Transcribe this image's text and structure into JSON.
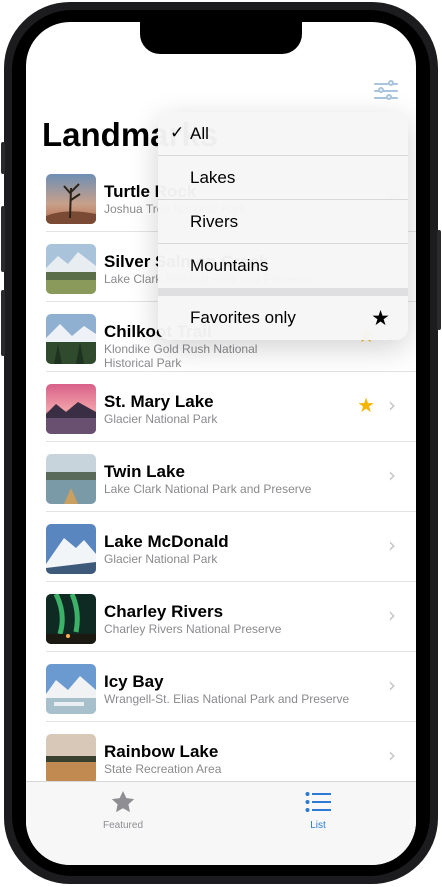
{
  "nav": {
    "title": "Landmarks",
    "filter_icon": "slider-horizontal-icon"
  },
  "filter_menu": {
    "items": [
      {
        "label": "All",
        "checked": true
      },
      {
        "label": "Lakes",
        "checked": false
      },
      {
        "label": "Rivers",
        "checked": false
      },
      {
        "label": "Mountains",
        "checked": false
      }
    ],
    "favorites_label": "Favorites only",
    "favorites_icon": "star-fill-icon"
  },
  "landmarks": [
    {
      "name": "Turtle Rock",
      "park": "Joshua Tree National Park",
      "favorite": false
    },
    {
      "name": "Silver Salmon Creek",
      "park": "Lake Clark National Park and Preserve",
      "favorite": false
    },
    {
      "name": "Chilkoot Trail",
      "park": "Klondike Gold Rush National Historical Park",
      "favorite": true
    },
    {
      "name": "St. Mary Lake",
      "park": "Glacier National Park",
      "favorite": true
    },
    {
      "name": "Twin Lake",
      "park": "Lake Clark National Park and Preserve",
      "favorite": false
    },
    {
      "name": "Lake McDonald",
      "park": "Glacier National Park",
      "favorite": false
    },
    {
      "name": "Charley Rivers",
      "park": "Charley Rivers National Preserve",
      "favorite": false
    },
    {
      "name": "Icy Bay",
      "park": "Wrangell-St. Elias National Park and Preserve",
      "favorite": false
    },
    {
      "name": "Rainbow Lake",
      "park": "State Recreation Area",
      "favorite": false
    }
  ],
  "tabs": [
    {
      "label": "Featured",
      "icon": "star-fill-icon",
      "selected": false
    },
    {
      "label": "List",
      "icon": "list-bullet-icon",
      "selected": true
    }
  ],
  "colors": {
    "accent": "#2b7bd4",
    "favorite_star": "#f4b400"
  }
}
